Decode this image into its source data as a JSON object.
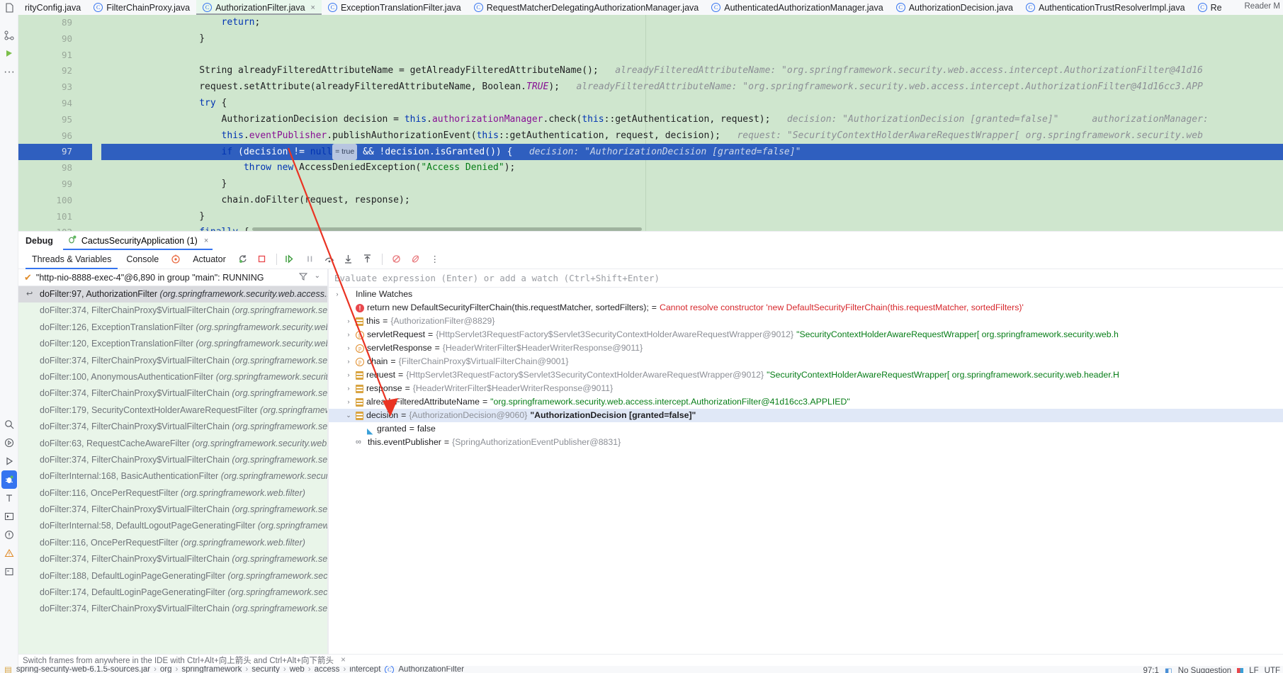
{
  "tabs": {
    "leading_icon": "file-icon",
    "items": [
      {
        "label": "rityConfig.java",
        "icon": null,
        "active": false,
        "truncated": true
      },
      {
        "label": "FilterChainProxy.java",
        "icon": "class-icon",
        "active": false
      },
      {
        "label": "AuthorizationFilter.java",
        "icon": "class-icon",
        "active": true,
        "closeable": true
      },
      {
        "label": "ExceptionTranslationFilter.java",
        "icon": "class-icon",
        "active": false
      },
      {
        "label": "RequestMatcherDelegatingAuthorizationManager.java",
        "icon": "class-icon",
        "active": false
      },
      {
        "label": "AuthenticatedAuthorizationManager.java",
        "icon": "class-icon",
        "active": false
      },
      {
        "label": "AuthorizationDecision.java",
        "icon": "class-icon",
        "active": false
      },
      {
        "label": "AuthenticationTrustResolverImpl.java",
        "icon": "class-icon",
        "active": false
      },
      {
        "label": "Re",
        "icon": "class-icon",
        "active": false,
        "truncated": true
      }
    ],
    "reader_mode": "Reader M"
  },
  "rail": {
    "top_icons": [
      "structure-icon",
      "bookmarks-icon",
      "more-icon"
    ],
    "bottom_icons": [
      "search-icon",
      "run-anything-icon",
      "run-icon",
      "debug-icon",
      "terminal-icon",
      "todo-icon",
      "problems-icon",
      "notifications-icon",
      "build-icon"
    ]
  },
  "editor": {
    "lines": [
      {
        "num": "89",
        "fold": "",
        "indent": 5,
        "tokens": [
          {
            "t": "return",
            "c": "k"
          },
          {
            "t": ";",
            "c": ""
          }
        ]
      },
      {
        "num": "90",
        "fold": "",
        "indent": 4,
        "tokens": [
          {
            "t": "}",
            "c": ""
          }
        ]
      },
      {
        "num": "91",
        "fold": "",
        "indent": 0,
        "tokens": []
      },
      {
        "num": "92",
        "fold": "",
        "indent": 4,
        "tokens": [
          {
            "t": "String alreadyFilteredAttributeName = getAlreadyFilteredAttributeName();",
            "c": ""
          }
        ],
        "hint": "alreadyFilteredAttributeName: \"org.springframework.security.web.access.intercept.AuthorizationFilter@41d16"
      },
      {
        "num": "93",
        "fold": "",
        "indent": 4,
        "tokens": [
          {
            "t": "request.setAttribute(alreadyFilteredAttributeName, Boolean.",
            "c": ""
          },
          {
            "t": "TRUE",
            "c": "st"
          },
          {
            "t": ");",
            "c": ""
          }
        ],
        "hint": "alreadyFilteredAttributeName: \"org.springframework.security.web.access.intercept.AuthorizationFilter@41d16cc3.APP"
      },
      {
        "num": "94",
        "fold": "",
        "indent": 4,
        "tokens": [
          {
            "t": "try",
            "c": "k"
          },
          {
            "t": " {",
            "c": ""
          }
        ]
      },
      {
        "num": "95",
        "fold": "",
        "indent": 5,
        "tokens": [
          {
            "t": "AuthorizationDecision decision = ",
            "c": ""
          },
          {
            "t": "this",
            "c": "k"
          },
          {
            "t": ".",
            "c": ""
          },
          {
            "t": "authorizationManager",
            "c": "f"
          },
          {
            "t": ".check(",
            "c": ""
          },
          {
            "t": "this",
            "c": "k"
          },
          {
            "t": "::getAuthentication, request);",
            "c": ""
          }
        ],
        "hint": "decision: \"AuthorizationDecision [granted=false]\"",
        "hint2": "authorizationManager:"
      },
      {
        "num": "96",
        "fold": "",
        "indent": 5,
        "tokens": [
          {
            "t": "this",
            "c": "k"
          },
          {
            "t": ".",
            "c": ""
          },
          {
            "t": "eventPublisher",
            "c": "f"
          },
          {
            "t": ".publishAuthorizationEvent(",
            "c": ""
          },
          {
            "t": "this",
            "c": "k"
          },
          {
            "t": "::getAuthentication, request, decision);",
            "c": ""
          }
        ],
        "hint": "request: \"SecurityContextHolderAwareRequestWrapper[ org.springframework.security.web"
      },
      {
        "num": "97",
        "fold": "",
        "indent": 5,
        "highlight": true,
        "tokens": [
          {
            "t": "if",
            "c": "k"
          },
          {
            "t": " (decision != ",
            "c": ""
          },
          {
            "t": "null",
            "c": "k"
          },
          {
            "t": "@CHIP@",
            "c": "chip"
          },
          {
            "t": " && !decision.isGranted()) {",
            "c": ""
          }
        ],
        "chip": "= true",
        "hint": "decision: \"AuthorizationDecision [granted=false]\""
      },
      {
        "num": "98",
        "fold": "",
        "indent": 6,
        "tokens": [
          {
            "t": "throw",
            "c": "k"
          },
          {
            "t": " ",
            "c": ""
          },
          {
            "t": "new",
            "c": "k"
          },
          {
            "t": " AccessDeniedException(",
            "c": ""
          },
          {
            "t": "\"Access Denied\"",
            "c": "s"
          },
          {
            "t": ");",
            "c": ""
          }
        ]
      },
      {
        "num": "99",
        "fold": "",
        "indent": 5,
        "tokens": [
          {
            "t": "}",
            "c": ""
          }
        ]
      },
      {
        "num": "100",
        "fold": "",
        "indent": 5,
        "tokens": [
          {
            "t": "chain.doFilter(request, response);",
            "c": ""
          }
        ]
      },
      {
        "num": "101",
        "fold": "",
        "indent": 4,
        "tokens": [
          {
            "t": "}",
            "c": ""
          }
        ]
      },
      {
        "num": "102",
        "fold": "",
        "indent": 4,
        "tokens": [
          {
            "t": "finally",
            "c": "k"
          },
          {
            "t": " {",
            "c": ""
          }
        ]
      }
    ]
  },
  "debug": {
    "title": "Debug",
    "run_tab": "CactusSecurityApplication (1)",
    "run_tab_icon": "debug-run-icon",
    "run_tab_close": "×",
    "tabs": [
      {
        "label": "Threads & Variables",
        "active": true
      },
      {
        "label": "Console",
        "active": false
      },
      {
        "label": "Actuator",
        "active": false,
        "icon": "actuator-icon"
      }
    ],
    "toolbar_icons": [
      "rerun-icon",
      "stop-icon",
      "resume-icon",
      "pause-icon",
      "step-over-icon",
      "step-into-icon",
      "step-out-icon",
      "mute-breakpoints-icon",
      "view-breakpoints-icon",
      "more-options-icon"
    ],
    "thread": {
      "status_icon": "check-icon",
      "label": "\"http-nio-8888-exec-4\"@6,890 in group \"main\": RUNNING",
      "filter_icon": "filter-icon",
      "chevron_icon": "chevron-down-icon"
    },
    "frames": [
      {
        "method": "doFilter:97, AuthorizationFilter ",
        "pkg": "(org.springframework.security.web.access.in",
        "selected": true,
        "return_icon": "return-arrow-icon"
      },
      {
        "method": "doFilter:374, FilterChainProxy$VirtualFilterChain ",
        "pkg": "(org.springframework.secur"
      },
      {
        "method": "doFilter:126, ExceptionTranslationFilter ",
        "pkg": "(org.springframework.security.web."
      },
      {
        "method": "doFilter:120, ExceptionTranslationFilter ",
        "pkg": "(org.springframework.security.web."
      },
      {
        "method": "doFilter:374, FilterChainProxy$VirtualFilterChain ",
        "pkg": "(org.springframework.secur"
      },
      {
        "method": "doFilter:100, AnonymousAuthenticationFilter ",
        "pkg": "(org.springframework.security."
      },
      {
        "method": "doFilter:374, FilterChainProxy$VirtualFilterChain ",
        "pkg": "(org.springframework.secur"
      },
      {
        "method": "doFilter:179, SecurityContextHolderAwareRequestFilter ",
        "pkg": "(org.springframewor"
      },
      {
        "method": "doFilter:374, FilterChainProxy$VirtualFilterChain ",
        "pkg": "(org.springframework.secur"
      },
      {
        "method": "doFilter:63, RequestCacheAwareFilter ",
        "pkg": "(org.springframework.security.web.sa"
      },
      {
        "method": "doFilter:374, FilterChainProxy$VirtualFilterChain ",
        "pkg": "(org.springframework.secur"
      },
      {
        "method": "doFilterInternal:168, BasicAuthenticationFilter ",
        "pkg": "(org.springframework.security"
      },
      {
        "method": "doFilter:116, OncePerRequestFilter ",
        "pkg": "(org.springframework.web.filter)"
      },
      {
        "method": "doFilter:374, FilterChainProxy$VirtualFilterChain ",
        "pkg": "(org.springframework.secur"
      },
      {
        "method": "doFilterInternal:58, DefaultLogoutPageGeneratingFilter ",
        "pkg": "(org.springframewor"
      },
      {
        "method": "doFilter:116, OncePerRequestFilter ",
        "pkg": "(org.springframework.web.filter)"
      },
      {
        "method": "doFilter:374, FilterChainProxy$VirtualFilterChain ",
        "pkg": "(org.springframework.secur"
      },
      {
        "method": "doFilter:188, DefaultLoginPageGeneratingFilter ",
        "pkg": "(org.springframework.securit"
      },
      {
        "method": "doFilter:174, DefaultLoginPageGeneratingFilter ",
        "pkg": "(org.springframework.securit"
      },
      {
        "method": "doFilter:374, FilterChainProxy$VirtualFilterChain ",
        "pkg": "(org.springframework.secur"
      }
    ],
    "evaluate_placeholder": "Evaluate expression (Enter) or add a watch (Ctrl+Shift+Enter)",
    "variables": [
      {
        "indent": 0,
        "chev": "›",
        "icon": "group-icon",
        "label": "Inline Watches",
        "kind": "group"
      },
      {
        "indent": 1,
        "chev": "",
        "icon": "error-icon",
        "label": "return new DefaultSecurityFilterChain(this.requestMatcher, sortedFilters);",
        "eq": "=",
        "error": "Cannot resolve constructor 'new DefaultSecurityFilterChain(this.requestMatcher, sortedFilters)'"
      },
      {
        "indent": 1,
        "chev": "›",
        "icon": "field-icon",
        "label": "this",
        "eq": "=",
        "ref": "{AuthorizationFilter@8829}"
      },
      {
        "indent": 1,
        "chev": "›",
        "icon": "param-icon",
        "label": "servletRequest",
        "eq": "=",
        "ref": "{HttpServlet3RequestFactory$Servlet3SecurityContextHolderAwareRequestWrapper@9012}",
        "str": "\"SecurityContextHolderAwareRequestWrapper[ org.springframework.security.web.h"
      },
      {
        "indent": 1,
        "chev": "›",
        "icon": "param-icon",
        "label": "servletResponse",
        "eq": "=",
        "ref": "{HeaderWriterFilter$HeaderWriterResponse@9011}"
      },
      {
        "indent": 1,
        "chev": "›",
        "icon": "param-icon",
        "label": "chain",
        "eq": "=",
        "ref": "{FilterChainProxy$VirtualFilterChain@9001}"
      },
      {
        "indent": 1,
        "chev": "›",
        "icon": "field-icon",
        "label": "request",
        "eq": "=",
        "ref": "{HttpServlet3RequestFactory$Servlet3SecurityContextHolderAwareRequestWrapper@9012}",
        "str": "\"SecurityContextHolderAwareRequestWrapper[ org.springframework.security.web.header.H"
      },
      {
        "indent": 1,
        "chev": "›",
        "icon": "field-icon",
        "label": "response",
        "eq": "=",
        "ref": "{HeaderWriterFilter$HeaderWriterResponse@9011}"
      },
      {
        "indent": 1,
        "chev": "›",
        "icon": "field-icon",
        "label": "alreadyFilteredAttributeName",
        "eq": "=",
        "str": "\"org.springframework.security.web.access.intercept.AuthorizationFilter@41d16cc3.APPLIED\""
      },
      {
        "indent": 1,
        "chev": "⌄",
        "icon": "field-icon",
        "label": "decision",
        "eq": "=",
        "ref": "{AuthorizationDecision@9060}",
        "bold": "\"AuthorizationDecision [granted=false]\"",
        "selected": true
      },
      {
        "indent": 2,
        "chev": "",
        "icon": "bool-icon",
        "label": "granted",
        "eq": "=",
        "plain": "false"
      },
      {
        "indent": 1,
        "chev": "",
        "icon": "link-icon",
        "label": "this.eventPublisher",
        "eq": "=",
        "ref": "{SpringAuthorizationEventPublisher@8831}"
      }
    ]
  },
  "hint_bar": {
    "text": "Switch frames from anywhere in the IDE with Ctrl+Alt+向上箭头 and Ctrl+Alt+向下箭头",
    "close": "×"
  },
  "status_bar": {
    "breadcrumbs": [
      "spring-security-web-6.1.5-sources.jar",
      "org",
      "springframework",
      "security",
      "web",
      "access",
      "intercept"
    ],
    "class_label": "AuthorizationFilter",
    "caret": "97:1",
    "suggestion": "No Suggestion",
    "lf": "LF",
    "encoding": "UTF"
  },
  "colors": {
    "editor_bg": "#cfe6ce",
    "highlight_line": "#2f5fbf",
    "accent_blue": "#3574f0",
    "keyword": "#0033b3",
    "string": "#067d17",
    "field": "#871094",
    "error_red": "#d6262b",
    "frames_bg": "#e9f5e9",
    "selected_var": "#e0e8f7"
  }
}
